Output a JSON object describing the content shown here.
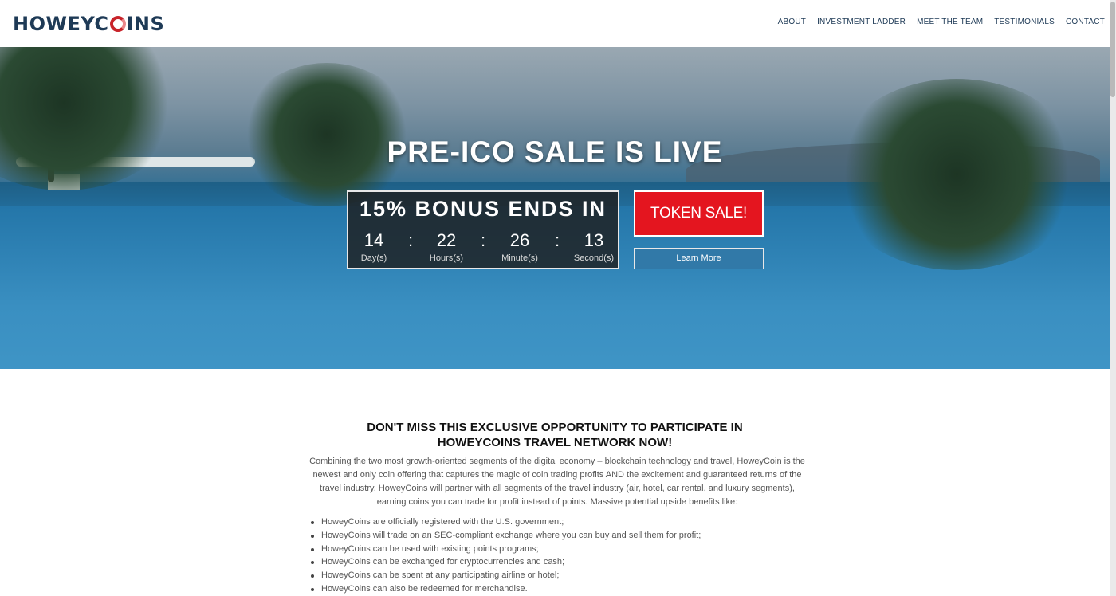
{
  "brand": {
    "logo_pre": "HOWEYC",
    "logo_post": "INS"
  },
  "nav": {
    "items": [
      "ABOUT",
      "INVESTMENT LADDER",
      "MEET THE TEAM",
      "TESTIMONIALS",
      "CONTACT"
    ]
  },
  "hero": {
    "headline": "PRE-ICO SALE IS LIVE",
    "countdown": {
      "title": "15% BONUS ENDS IN",
      "days": "14",
      "hours": "22",
      "minutes": "26",
      "seconds": "13",
      "separator": ":",
      "days_label": "Day(s)",
      "hours_label": "Hours(s)",
      "minutes_label": "Minute(s)",
      "seconds_label": "Second(s)"
    },
    "token_button": "TOKEN SALE!",
    "learn_button": "Learn More"
  },
  "intro": {
    "heading_line1": "DON'T MISS THIS EXCLUSIVE OPPORTUNITY TO PARTICIPATE IN",
    "heading_line2": "HOWEYCOINS TRAVEL NETWORK NOW!",
    "paragraph": "Combining the two most growth-oriented segments of the digital economy – blockchain technology and travel, HoweyCoin is the newest and only coin offering that captures the magic of coin trading profits AND the excitement and guaranteed returns of the travel industry. HoweyCoins will partner with all segments of the travel industry (air, hotel, car rental, and luxury segments), earning coins you can trade for profit instead of points. Massive potential upside benefits like:",
    "bullets": [
      "HoweyCoins are officially registered with the U.S. government;",
      "HoweyCoins will trade on an SEC-compliant exchange where you can buy and sell them for profit;",
      "HoweyCoins can be used with existing points programs;",
      "HoweyCoins can be exchanged for cryptocurrencies and cash;",
      "HoweyCoins can be spent at any participating airline or hotel;",
      "HoweyCoins can also be redeemed for merchandise."
    ]
  },
  "colors": {
    "navy": "#1e3a56",
    "accent_red": "#e4151f",
    "learn_blue": "#3179a8"
  }
}
